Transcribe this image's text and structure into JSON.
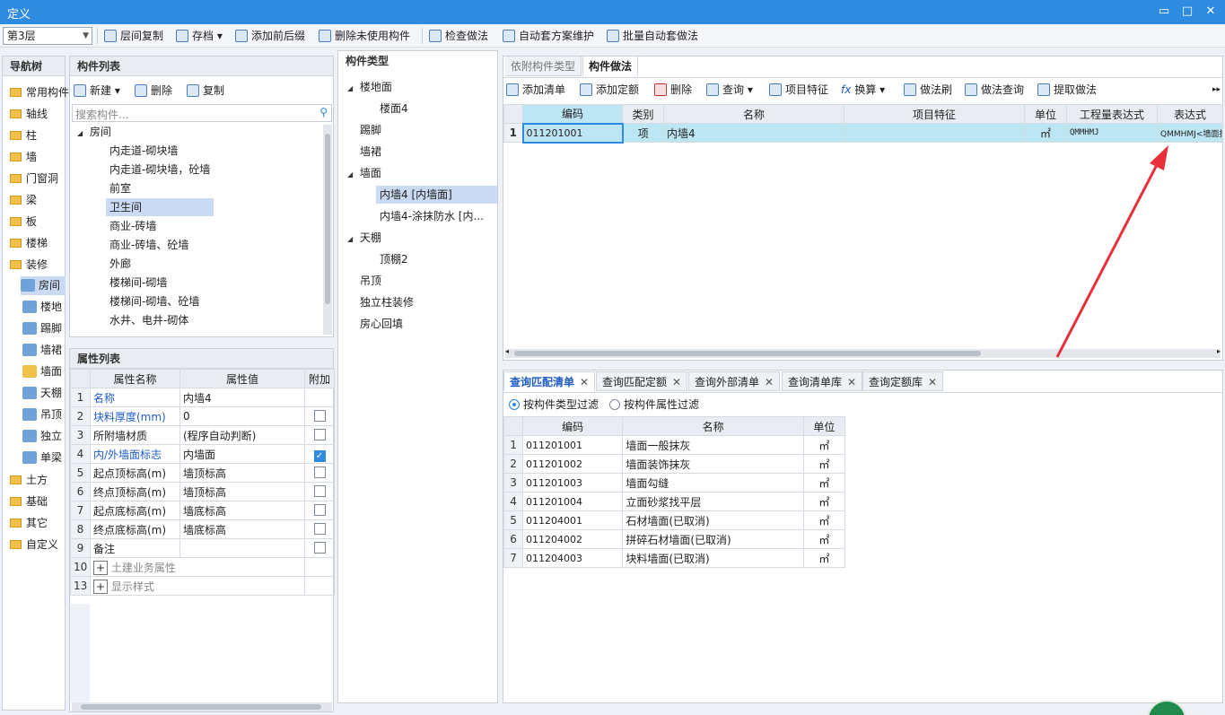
{
  "window": {
    "title": "定义",
    "min": "▭",
    "max": "□",
    "close": "✕"
  },
  "toolbar": {
    "floor": "第3层",
    "items": [
      "层间复制",
      "存档",
      "添加前后缀",
      "删除未使用构件",
      "检查做法",
      "自动套方案维护",
      "批量自动套做法"
    ]
  },
  "nav": {
    "title": "导航树",
    "groups": [
      "常用构件",
      "轴线",
      "柱",
      "墙",
      "门窗洞",
      "梁",
      "板",
      "楼梯",
      "装修"
    ],
    "subitems": [
      "房间",
      "楼地",
      "踢脚",
      "墙裙",
      "墙面",
      "天棚",
      "吊顶",
      "独立",
      "单梁"
    ],
    "after": [
      "土方",
      "基础",
      "其它",
      "自定义"
    ]
  },
  "comp": {
    "title": "构件列表",
    "new": "新建",
    "del": "删除",
    "copy": "复制",
    "search": "搜索构件...",
    "root": "房间",
    "items": [
      "内走道-砌块墙",
      "内走道-砌块墙，砼墙",
      "前室",
      "卫生间",
      "商业-砖墙",
      "商业-砖墙、砼墙",
      "外廊",
      "楼梯间-砌墙",
      "楼梯间-砌墙、砼墙",
      "水井、电井-砌体"
    ]
  },
  "props": {
    "title": "属性列表",
    "h_name": "属性名称",
    "h_val": "属性值",
    "h_add": "附加",
    "rows": [
      {
        "n": "1",
        "name": "名称",
        "val": "内墙4"
      },
      {
        "n": "2",
        "name": "块料厚度(mm)",
        "val": "0"
      },
      {
        "n": "3",
        "name": "所附墙材质",
        "val": "(程序自动判断)"
      },
      {
        "n": "4",
        "name": "内/外墙面标志",
        "val": "内墙面"
      },
      {
        "n": "5",
        "name": "起点顶标高(m)",
        "val": "墙顶标高"
      },
      {
        "n": "6",
        "name": "终点顶标高(m)",
        "val": "墙顶标高"
      },
      {
        "n": "7",
        "name": "起点底标高(m)",
        "val": "墙底标高"
      },
      {
        "n": "8",
        "name": "终点底标高(m)",
        "val": "墙底标高"
      },
      {
        "n": "9",
        "name": "备注",
        "val": ""
      },
      {
        "n": "10",
        "name": "土建业务属性",
        "val": ""
      },
      {
        "n": "13",
        "name": "显示样式",
        "val": ""
      }
    ]
  },
  "ctype": {
    "title": "构件类型",
    "items": [
      "楼地面",
      "楼面4",
      "踢脚",
      "墙裙",
      "墙面",
      "内墙4 [内墙面]",
      "内墙4-涂抹防水 [内...",
      "天棚",
      "顶棚2",
      "吊顶",
      "独立柱装修",
      "房心回填"
    ]
  },
  "right": {
    "tab1": "依附构件类型",
    "tab2": "构件做法",
    "tools": [
      "添加清单",
      "添加定额",
      "删除",
      "查询",
      "项目特征",
      "换算",
      "做法刷",
      "做法查询",
      "提取做法"
    ],
    "cols": [
      "编码",
      "类别",
      "名称",
      "项目特征",
      "单位",
      "工程量表达式",
      "表达式"
    ],
    "row": {
      "n": "1",
      "code": "011201001",
      "cat": "项",
      "name": "内墙4",
      "feat": "",
      "unit": "㎡",
      "expr": "QMMHMJ",
      "expr2": "QMMHMJ<墙面抹"
    }
  },
  "bottom": {
    "tabs": [
      "查询匹配清单",
      "查询匹配定额",
      "查询外部清单",
      "查询清单库",
      "查询定额库"
    ],
    "r1": "按构件类型过滤",
    "r2": "按构件属性过滤",
    "cols": [
      "编码",
      "名称",
      "单位"
    ],
    "rows": [
      {
        "n": "1",
        "code": "011201001",
        "name": "墙面一般抹灰",
        "unit": "㎡"
      },
      {
        "n": "2",
        "code": "011201002",
        "name": "墙面装饰抹灰",
        "unit": "㎡"
      },
      {
        "n": "3",
        "code": "011201003",
        "name": "墙面勾缝",
        "unit": "㎡"
      },
      {
        "n": "4",
        "code": "011201004",
        "name": "立面砂浆找平层",
        "unit": "㎡"
      },
      {
        "n": "5",
        "code": "011204001",
        "name": "石材墙面(已取消)",
        "unit": "㎡"
      },
      {
        "n": "6",
        "code": "011204002",
        "name": "拼碎石材墙面(已取消)",
        "unit": "㎡"
      },
      {
        "n": "7",
        "code": "011204003",
        "name": "块料墙面(已取消)",
        "unit": "㎡"
      }
    ]
  },
  "colors": {
    "accent": "#2f8be0",
    "highlight": "#bde6f5",
    "arrow": "#e8303a"
  }
}
